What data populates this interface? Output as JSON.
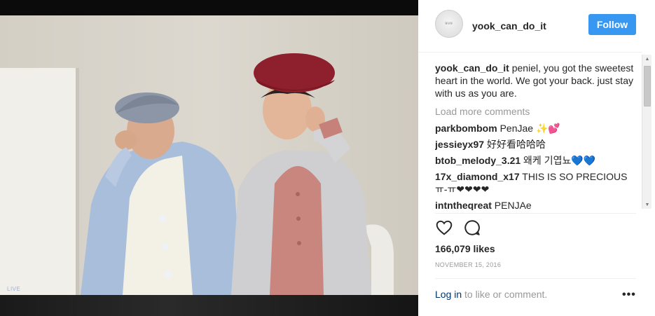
{
  "post": {
    "watermark": "LIVE"
  },
  "header": {
    "avatar_text": "ᵘᵘᵘ",
    "username": "yook_can_do_it",
    "follow_label": "Follow"
  },
  "caption": {
    "username": "yook_can_do_it",
    "text": "peniel, you got the sweetest heart in the world. We got your back. just stay with us as you are."
  },
  "load_more": "Load more comments",
  "comments": [
    {
      "user": "parkbombom",
      "text": "PenJae ✨💕"
    },
    {
      "user": "jessieyx97",
      "text": "好好看哈哈哈"
    },
    {
      "user": "btob_melody_3.21",
      "text": "왜케 기엽뇨💙💙"
    },
    {
      "user": "17x_diamond_x17",
      "text": "THIS IS SO PRECIOUS ㅠ-ㅠ❤❤❤❤"
    },
    {
      "user": "intntheqreat",
      "text": "PENJAe"
    }
  ],
  "actions": {
    "like_icon": "heart-outline",
    "comment_icon": "speech-bubble-outline"
  },
  "likes": "166,079 likes",
  "date": "NOVEMBER 15, 2016",
  "footer": {
    "login_link": "Log in",
    "login_suffix": " to like or comment.",
    "more_label": "•••"
  },
  "colors": {
    "follow_blue": "#3897f0",
    "link_navy": "#003569",
    "muted": "#999999"
  }
}
